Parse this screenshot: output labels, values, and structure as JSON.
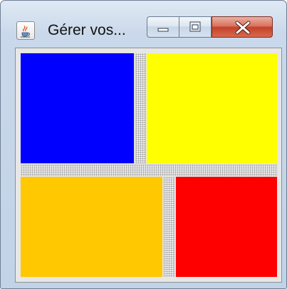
{
  "window": {
    "title": "Gérer vos...",
    "icon": "java-cup-icon",
    "controls": {
      "minimize": "minimize-icon",
      "maximize": "maximize-icon",
      "close": "close-icon"
    }
  },
  "panels": {
    "top_left": {
      "color": "#0000ff"
    },
    "top_right": {
      "color": "#ffff00"
    },
    "bottom_left": {
      "color": "#ffc800"
    },
    "bottom_right": {
      "color": "#ff0000"
    }
  }
}
